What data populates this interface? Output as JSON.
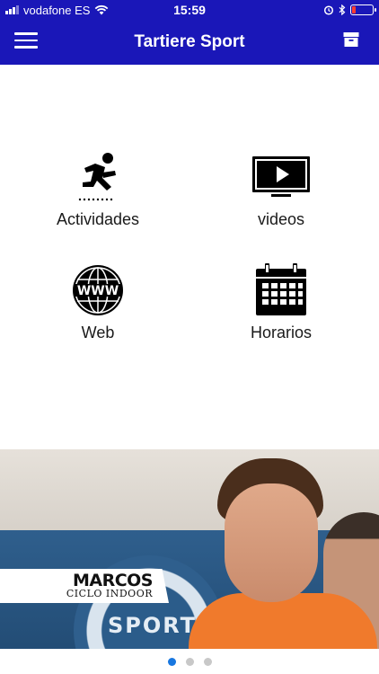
{
  "status_bar": {
    "carrier": "vodafone ES",
    "time": "15:59"
  },
  "header": {
    "title": "Tartiere Sport",
    "menu_icon": "hamburger-menu-icon",
    "right_icon": "archive-box-icon"
  },
  "tiles": [
    {
      "label": "Actividades",
      "icon": "sprinter-icon"
    },
    {
      "label": "videos",
      "icon": "tv-play-icon"
    },
    {
      "label": "Web",
      "icon": "www-globe-icon"
    },
    {
      "label": "Horarios",
      "icon": "calendar-icon"
    }
  ],
  "banner": {
    "name": "MARCOS",
    "subtitle": "CICLO INDOOR",
    "background_text": "SPORT"
  },
  "carousel": {
    "pages": 3,
    "active_index": 0
  },
  "colors": {
    "header_bg": "#1a17b8",
    "active_dot": "#1877e0",
    "inactive_dot": "#c8c8c8",
    "battery_low": "#ff3b30"
  }
}
